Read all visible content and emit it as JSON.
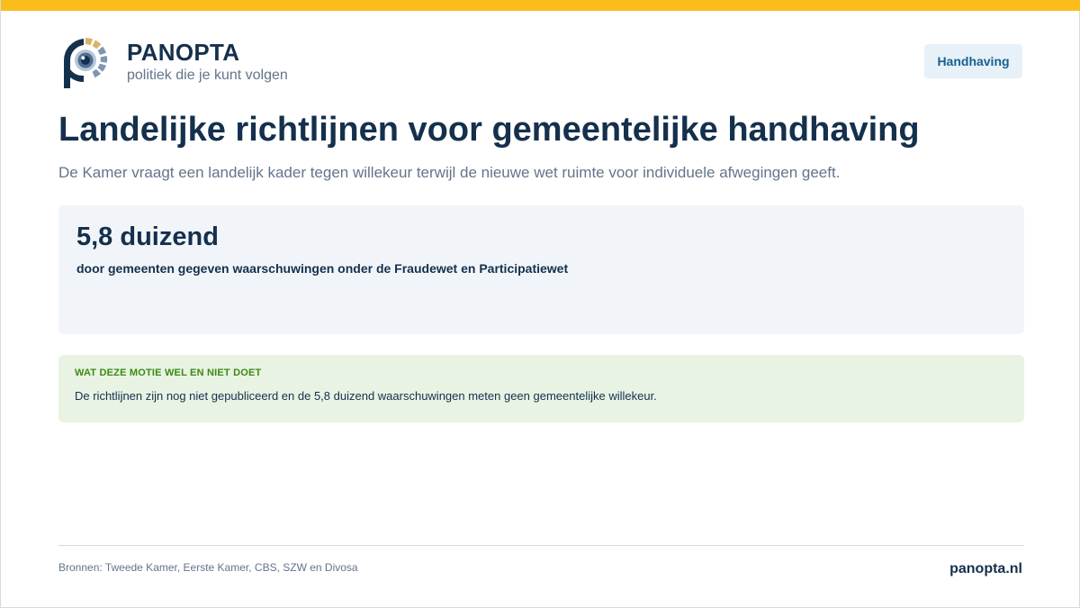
{
  "brand": {
    "name": "PANOPTA",
    "tagline": "politiek die je kunt volgen",
    "logo_icon": "panopta-eye-logo-icon"
  },
  "badge": {
    "label": "Handhaving"
  },
  "headline": "Landelijke richtlijnen voor gemeentelijke handhaving",
  "subline": "De Kamer vraagt een landelijk kader tegen willekeur terwijl de nieuwe wet ruimte voor individuele afwegingen geeft.",
  "stat": {
    "value": "5,8 duizend",
    "label": "door gemeenten gegeven waarschuwingen onder de Fraudewet en Participatiewet"
  },
  "note": {
    "title": "WAT DEZE MOTIE WEL EN NIET DOET",
    "text": "De richtlijnen zijn nog niet gepubliceerd en de 5,8 duizend waarschuwingen meten geen gemeentelijke willekeur."
  },
  "footer": {
    "sources": "Bronnen: Tweede Kamer, Eerste Kamer, CBS, SZW en Divosa",
    "site": "panopta.nl"
  },
  "colors": {
    "accent_bar": "#fbbd1c",
    "navy": "#14304d",
    "muted": "#64748b",
    "badge_bg": "#e8f1f8",
    "badge_text": "#16618f",
    "stat_bg": "#f1f5f9",
    "note_bg": "#e8f3e3",
    "note_title": "#3c8a12",
    "logo_gold": "#d8b46a",
    "logo_blue": "#7e96b0"
  }
}
